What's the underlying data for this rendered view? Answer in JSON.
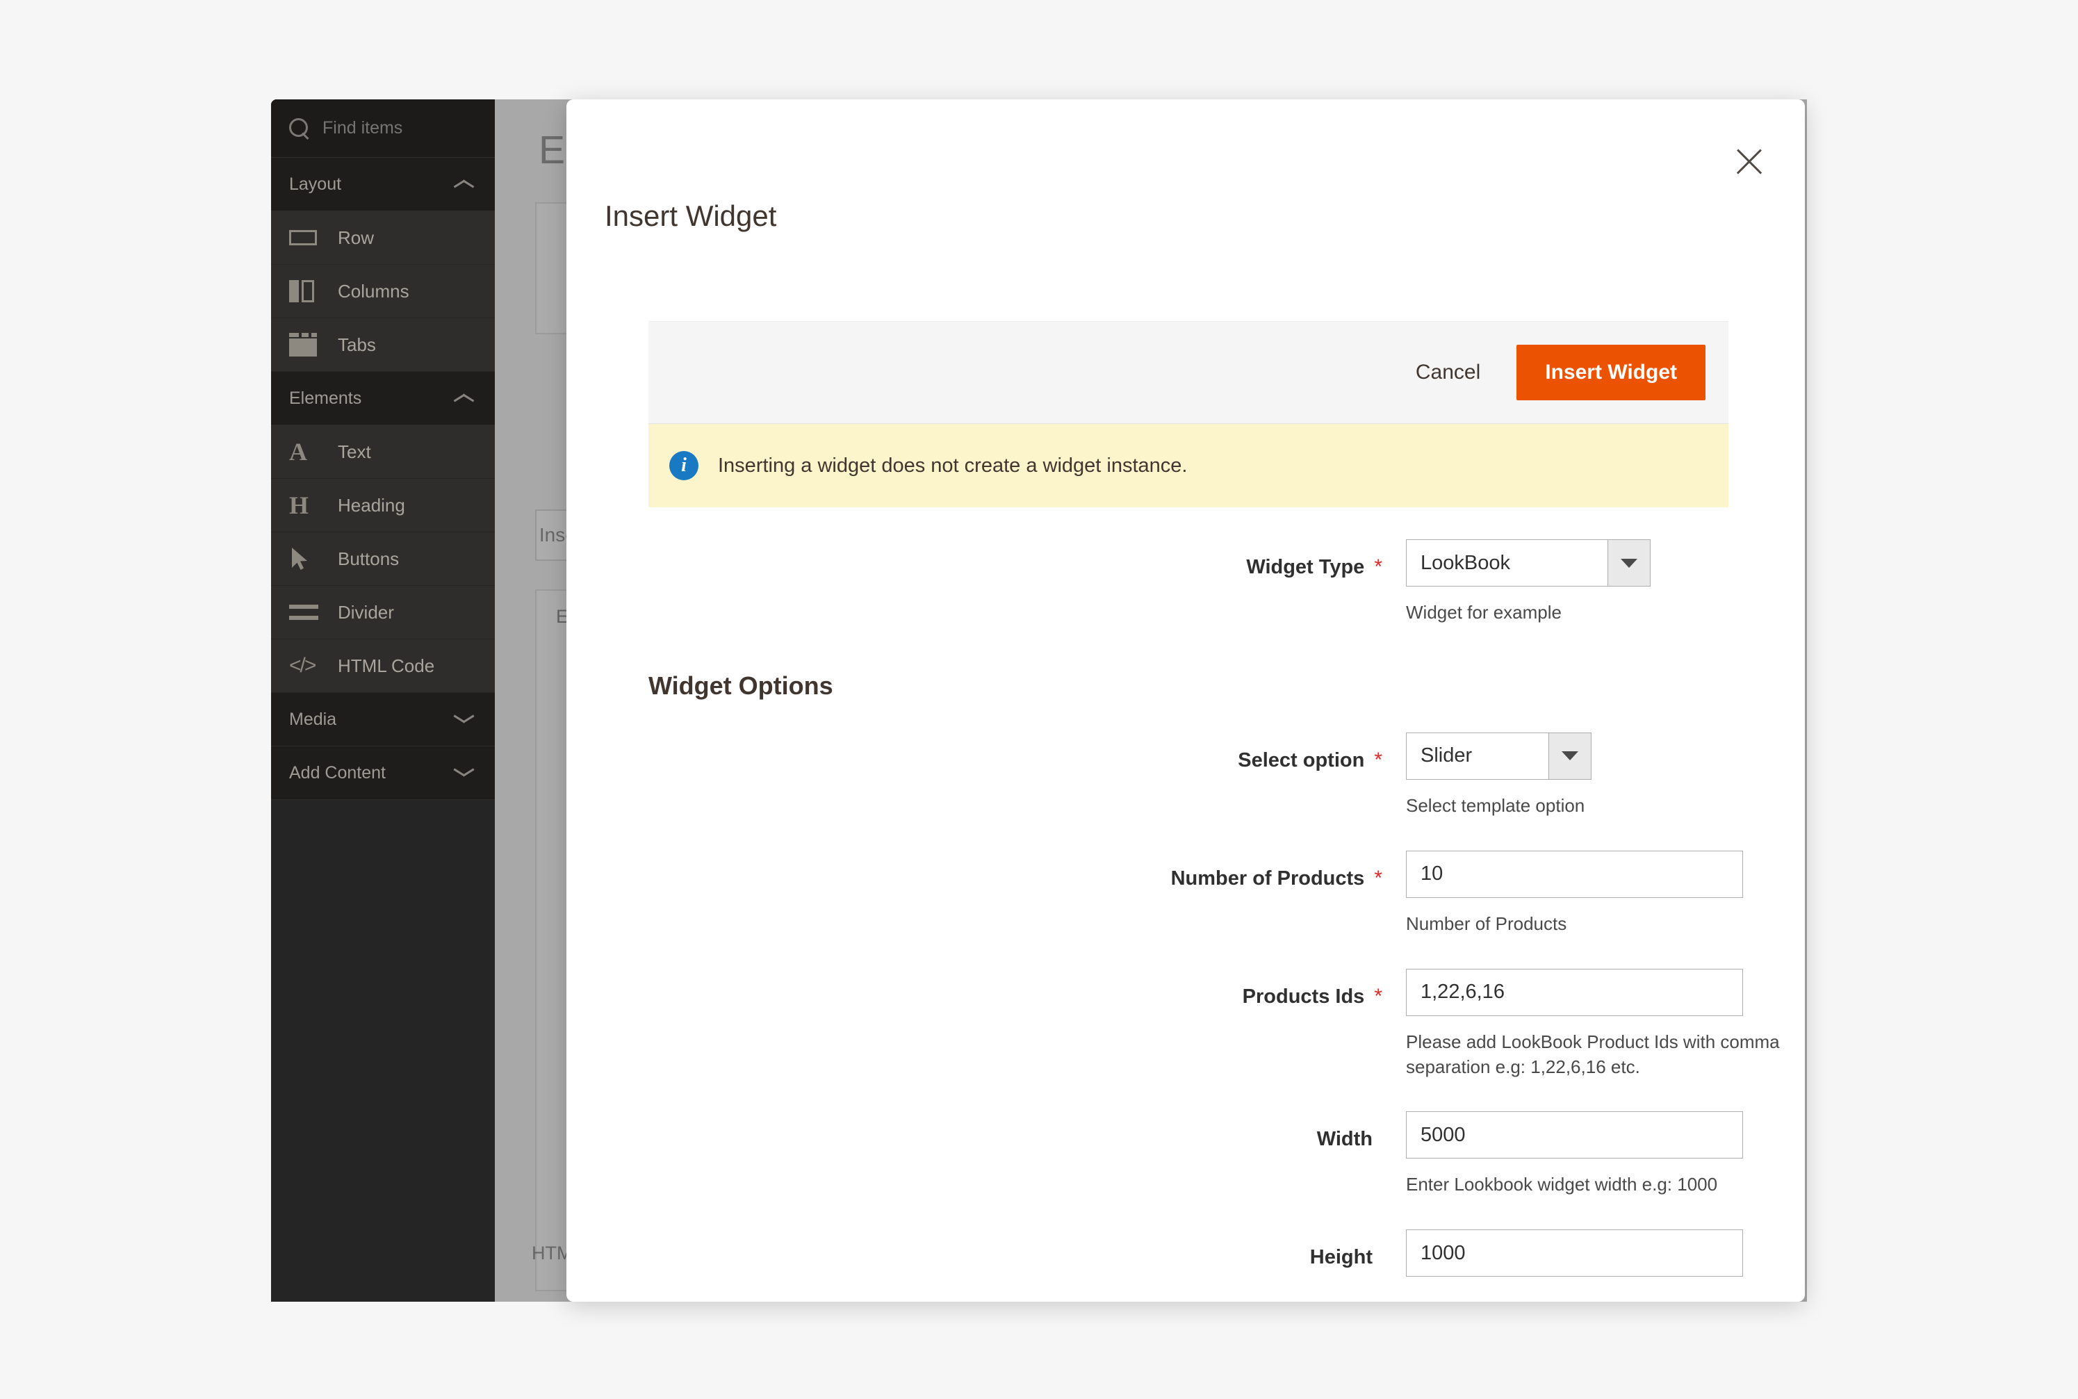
{
  "background": {
    "page_title": "Edit HTML Code",
    "panel_button_label": "Insert Widget...",
    "textarea_label": "Enter HTML Code",
    "footer_label": "HTML Code"
  },
  "sidebar": {
    "search": {
      "placeholder": "Find items",
      "icon": "search-icon"
    },
    "sections": [
      {
        "id": "layout",
        "label": "Layout",
        "expanded": true,
        "chevron": "chevron-up-icon",
        "items": [
          {
            "id": "row",
            "label": "Row",
            "icon": "row-icon"
          },
          {
            "id": "columns",
            "label": "Columns",
            "icon": "columns-icon"
          },
          {
            "id": "tabs",
            "label": "Tabs",
            "icon": "tabs-icon"
          }
        ]
      },
      {
        "id": "elements",
        "label": "Elements",
        "expanded": true,
        "chevron": "chevron-up-icon",
        "items": [
          {
            "id": "text",
            "label": "Text",
            "icon": "text-a-icon"
          },
          {
            "id": "heading",
            "label": "Heading",
            "icon": "heading-h-icon"
          },
          {
            "id": "buttons",
            "label": "Buttons",
            "icon": "cursor-arrow-icon"
          },
          {
            "id": "divider",
            "label": "Divider",
            "icon": "divider-icon"
          },
          {
            "id": "html-code",
            "label": "HTML Code",
            "icon": "code-brackets-icon"
          }
        ]
      },
      {
        "id": "media",
        "label": "Media",
        "expanded": false,
        "chevron": "chevron-down-icon",
        "items": []
      },
      {
        "id": "add-content",
        "label": "Add Content",
        "expanded": false,
        "chevron": "chevron-down-icon",
        "items": []
      }
    ]
  },
  "modal": {
    "title": "Insert Widget",
    "close_icon": "close-icon",
    "toolbar": {
      "cancel_label": "Cancel",
      "insert_label": "Insert Widget"
    },
    "notice": {
      "icon": "info-icon",
      "text": "Inserting a widget does not create a widget instance."
    },
    "widget_type": {
      "label": "Widget Type",
      "required": "*",
      "value": "LookBook",
      "note": "Widget for example"
    },
    "options_heading": "Widget Options",
    "fields": [
      {
        "id": "select-option",
        "label": "Select option",
        "required": "*",
        "type": "select",
        "value": "Slider",
        "note": "Select template option"
      },
      {
        "id": "number-of-products",
        "label": "Number of Products",
        "required": "*",
        "type": "text",
        "value": "10",
        "note": "Number of Products"
      },
      {
        "id": "products-ids",
        "label": "Products Ids",
        "required": "*",
        "type": "text",
        "value": "1,22,6,16",
        "note": "Please add LookBook Product Ids with comma separation e.g: 1,22,6,16 etc."
      },
      {
        "id": "width",
        "label": "Width",
        "required": "",
        "type": "text",
        "value": "5000",
        "note": "Enter Lookbook widget width e.g: 1000"
      },
      {
        "id": "height",
        "label": "Height",
        "required": "",
        "type": "text",
        "value": "1000",
        "note": ""
      }
    ]
  },
  "colors": {
    "accent": "#eb5202",
    "notice_bg": "#fcf5cc",
    "info_blue": "#1979c3",
    "required_red": "#e02b27",
    "sidebar_bg": "#252525"
  }
}
